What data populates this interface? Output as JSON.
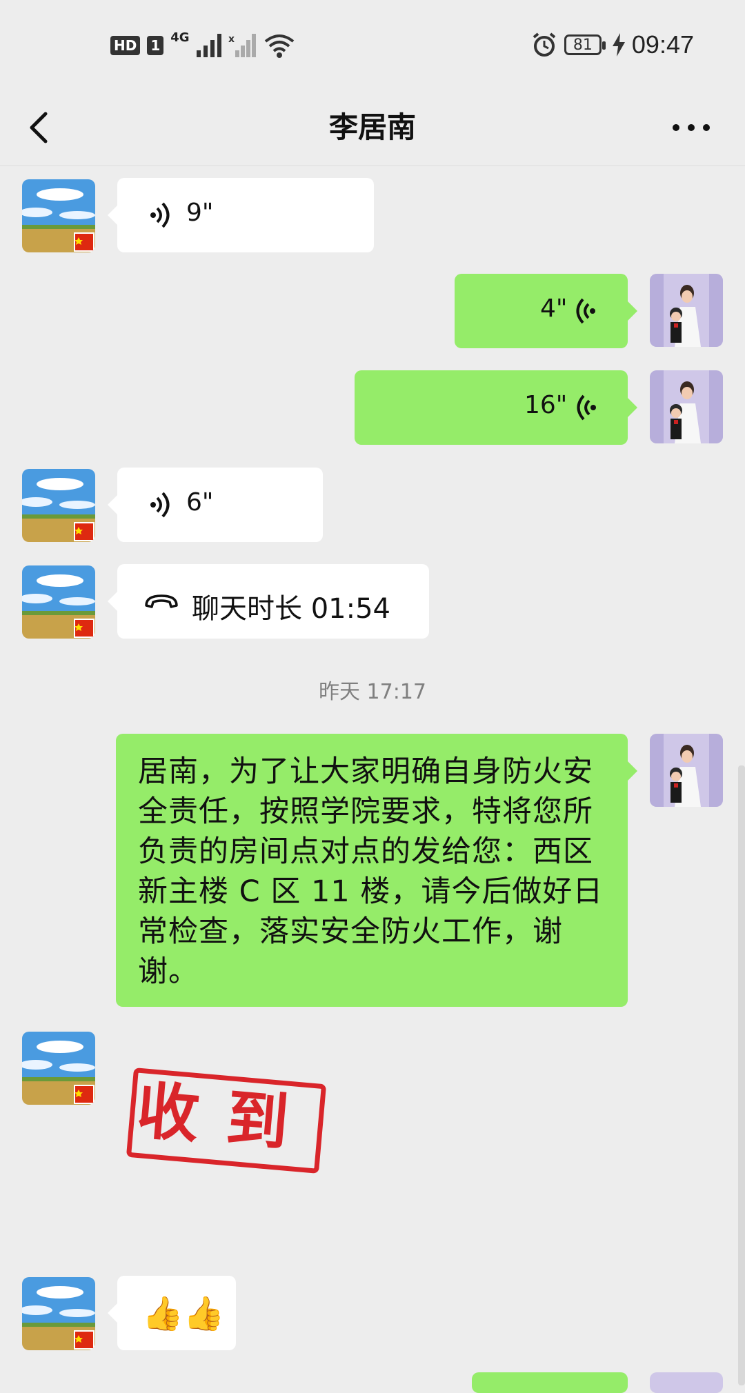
{
  "status_bar": {
    "hd": "HD",
    "sim": "1",
    "network": "4G",
    "battery": "81",
    "time": "09:47"
  },
  "nav": {
    "title": "李居南"
  },
  "messages": {
    "m1": {
      "duration": "9\""
    },
    "m2": {
      "duration": "4\""
    },
    "m3": {
      "duration": "16\""
    },
    "m4": {
      "duration": "6\""
    },
    "m5": {
      "call_text": "聊天时长 01:54"
    },
    "timestamp": "昨天 17:17",
    "m6": {
      "text": "居南，为了让大家明确自身防火安全责任，按照学院要求，特将您所负责的房间点对点的发给您：西区新主楼 C 区 11 楼，请今后做好日常检查，落实安全防火工作，谢谢。"
    },
    "m7": {
      "stamp_text": "收到"
    },
    "m8": {
      "emoji": "👍👍"
    }
  },
  "colors": {
    "background": "#ededed",
    "bubble_green": "#95ec69",
    "bubble_white": "#ffffff",
    "stamp_red": "#d9252a"
  }
}
